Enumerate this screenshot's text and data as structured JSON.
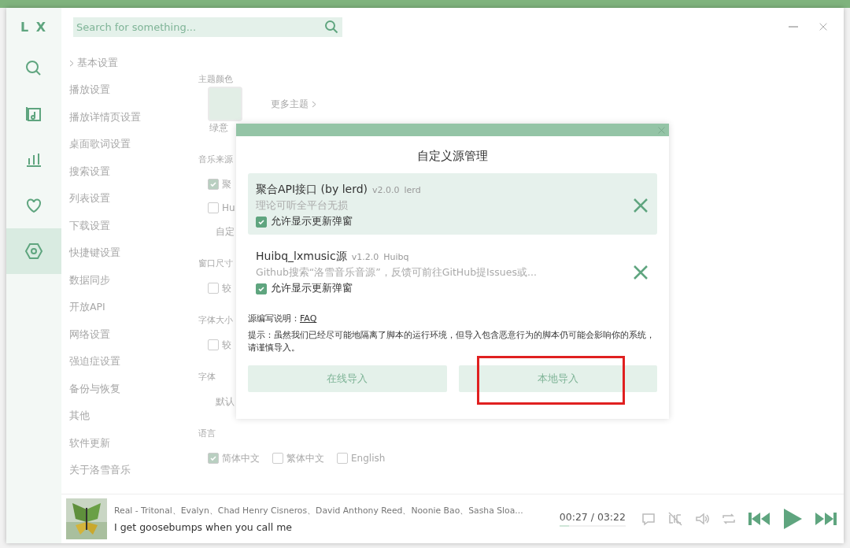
{
  "app": {
    "logo": "L X",
    "search": {
      "placeholder": "Search for something..."
    }
  },
  "sidebar": [
    {
      "selected": false
    },
    {
      "selected": false
    },
    {
      "selected": false
    },
    {
      "selected": false
    },
    {
      "selected": true
    }
  ],
  "settings_nav": [
    {
      "label": "基本设置",
      "expanded": true
    },
    {
      "label": "播放设置",
      "expanded": false
    },
    {
      "label": "播放详情页设置",
      "expanded": false
    },
    {
      "label": "桌面歌词设置",
      "expanded": false
    },
    {
      "label": "搜索设置",
      "expanded": false
    },
    {
      "label": "列表设置",
      "expanded": false
    },
    {
      "label": "下载设置",
      "expanded": false
    },
    {
      "label": "快捷键设置",
      "expanded": false
    },
    {
      "label": "数据同步",
      "expanded": false
    },
    {
      "label": "开放API",
      "expanded": false
    },
    {
      "label": "网络设置",
      "expanded": false
    },
    {
      "label": "强迫症设置",
      "expanded": false
    },
    {
      "label": "备份与恢复",
      "expanded": false
    },
    {
      "label": "其他",
      "expanded": false
    },
    {
      "label": "软件更新",
      "expanded": false
    },
    {
      "label": "关于洛雪音乐",
      "expanded": false
    }
  ],
  "settings": {
    "theme": {
      "label": "主题颜色",
      "theme_name": "绿意",
      "more": "更多主题"
    },
    "sections": [
      {
        "label": "音乐来源",
        "options": [
          {
            "kind": "checkbox",
            "label": "聚",
            "checked": true
          },
          {
            "kind": "checkbox",
            "label": "Hu",
            "checked": false
          },
          {
            "kind": "link",
            "label": "自定"
          }
        ]
      },
      {
        "label": "窗口尺寸",
        "options": [
          {
            "kind": "checkbox",
            "label": "较",
            "checked": false
          }
        ]
      },
      {
        "label": "字体大小",
        "options": [
          {
            "kind": "checkbox",
            "label": "较",
            "checked": false
          }
        ]
      },
      {
        "label": "字体",
        "options": [
          {
            "kind": "link",
            "label": "默认"
          }
        ]
      }
    ],
    "language": {
      "label": "语言",
      "options": [
        {
          "label": "简体中文",
          "checked": true
        },
        {
          "label": "繁体中文",
          "checked": false
        },
        {
          "label": "English",
          "checked": false
        }
      ]
    }
  },
  "dialog": {
    "title": "自定义源管理",
    "sources": [
      {
        "name": "聚合API接口 (by lerd)",
        "version": "v2.0.0",
        "author": "lerd",
        "description": "理论可听全平台无损",
        "allow_update_label": "允许显示更新弹窗",
        "allow_update": true,
        "selected": true
      },
      {
        "name": "Huibq_lxmusic源",
        "version": "v1.2.0",
        "author": "Huibq",
        "description": "Github搜索“洛雪音乐音源”，反馈可前往GitHub提Issues或...",
        "allow_update_label": "允许显示更新弹窗",
        "allow_update": true,
        "selected": false
      }
    ],
    "faq_label": "源编写说明：",
    "faq_link": "FAQ",
    "hint": "提示：虽然我们已经尽可能地隔离了脚本的运行环境，但导入包含恶意行为的脚本仍可能会影响你的系统，请谨慎导入。",
    "buttons": [
      {
        "label": "在线导入",
        "highlighted": false
      },
      {
        "label": "本地导入",
        "highlighted": true
      }
    ]
  },
  "player": {
    "artist": "Real - Tritonal、Evalyn、Chad Henry Cisneros、David Anthony Reed、Noonie Bao、Sasha Sloa...",
    "lyric": "I get goosebumps when you call me",
    "time": "00:27 / 03:22",
    "level": 0.14
  }
}
